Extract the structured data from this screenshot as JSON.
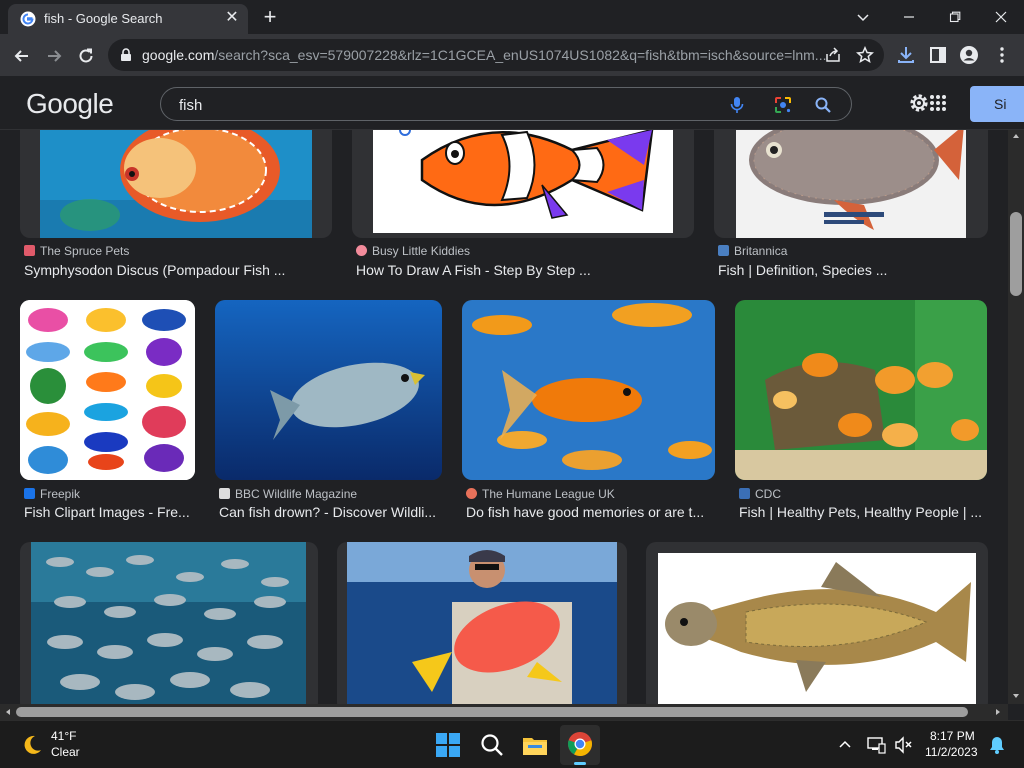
{
  "browser": {
    "tab_title": "fish - Google Search",
    "tab_close_icon": "close-icon",
    "new_tab_icon": "plus-icon",
    "window_controls": [
      "chevron-down-icon",
      "minimize-icon",
      "restore-icon",
      "close-icon"
    ],
    "url_domain": "google.com",
    "url_rest": "/search?sca_esv=579007228&rlz=1C1GCEA_enUS1074US1082&q=fish&tbm=isch&source=lnm...",
    "toolbar_icons": [
      "back-icon",
      "forward-icon",
      "reload-icon",
      "lock-icon",
      "share-icon",
      "star-icon",
      "download-icon",
      "sidepanel-icon",
      "profile-icon",
      "menu-icon"
    ]
  },
  "google": {
    "logo": "Google",
    "query": "fish",
    "signin_label": "Si",
    "header_icons": [
      "mic-icon",
      "lens-icon",
      "search-icon",
      "settings-icon",
      "apps-icon"
    ]
  },
  "results": {
    "row1": [
      {
        "source": "The Spruce Pets",
        "title": "Symphysodon Discus (Pompadour Fish ...",
        "source_color": "#e05a6a"
      },
      {
        "source": "Busy Little Kiddies",
        "title": "How To Draw A Fish - Step By Step ...",
        "source_color": "#f28b9b"
      },
      {
        "source": "Britannica",
        "title": "Fish | Definition, Species ...",
        "source_color": "#4a7fc1"
      }
    ],
    "row2": [
      {
        "source": "Freepik",
        "title": "Fish Clipart Images - Fre...",
        "source_color": "#1a73e8"
      },
      {
        "source": "BBC Wildlife Magazine",
        "title": "Can fish drown? - Discover Wildli...",
        "source_color": "#dddddd"
      },
      {
        "source": "The Humane League UK",
        "title": "Do fish have good memories or are t...",
        "source_color": "#e8715a"
      },
      {
        "source": "CDC",
        "title": "Fish | Healthy Pets, Healthy People | ...",
        "source_color": "#3b6fb6"
      }
    ]
  },
  "taskbar": {
    "temp": "41°F",
    "condition": "Clear",
    "time": "8:17 PM",
    "date": "11/2/2023",
    "apps": [
      "windows-start-icon",
      "search-icon",
      "file-explorer-icon",
      "chrome-icon"
    ],
    "tray_icons": [
      "chevron-up-icon",
      "network-icon",
      "volume-muted-icon",
      "notification-bell-icon"
    ]
  }
}
